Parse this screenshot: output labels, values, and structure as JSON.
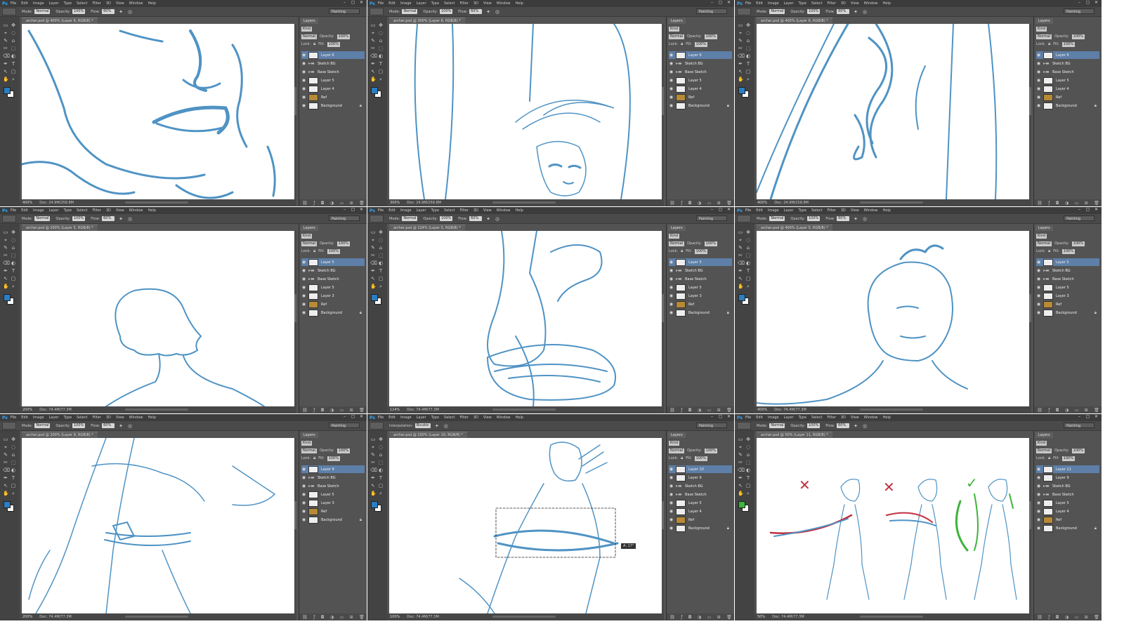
{
  "ps_logo": "Ps",
  "menus": [
    "File",
    "Edit",
    "Image",
    "Layer",
    "Type",
    "Select",
    "Filter",
    "3D",
    "View",
    "Window",
    "Help"
  ],
  "window_controls": [
    "–",
    "▢",
    "✕"
  ],
  "workspace": "Painting",
  "options": {
    "mode_label": "Mode:",
    "mode_value": "Normal",
    "opacity_label": "Opacity:",
    "opacity_value": "100%",
    "flow_label": "Flow:",
    "flow_value": "60%"
  },
  "colors": {
    "fg_swatch": "#2a7fc4",
    "fg_swatch_green": "#38b83a",
    "bg_swatch": "#ffffff",
    "sketch_stroke": "#4f93c4",
    "sketch_stroke_light": "#9cc6e2",
    "red_mark": "#c23040",
    "green_mark": "#3fb33a",
    "layer_selected": "#5d7fa8"
  },
  "layers_panel": {
    "tab": "Layers",
    "kind_value": "Kind",
    "blend_value": "Normal",
    "opacity_label": "Opacity:",
    "opacity_value": "100%",
    "lock_label": "Lock:",
    "fill_label": "Fill:",
    "fill_value": "100%"
  },
  "windows": [
    {
      "doc_tab": "archer.psd @ 400% (Layer 6, RGB/8) *",
      "zoom": "400%",
      "doc_info": "Doc: 24.9M/258.8M",
      "layers": [
        {
          "name": "Layer 6",
          "type": "layer",
          "selected": true
        },
        {
          "name": "Sketch BG",
          "type": "folder",
          "selected": false
        },
        {
          "name": "Base Sketch",
          "type": "folder",
          "selected": false
        },
        {
          "name": "Layer 5",
          "type": "layer",
          "selected": false
        },
        {
          "name": "Layer 4",
          "type": "layer",
          "selected": false
        },
        {
          "name": "Ref",
          "type": "ref",
          "selected": false
        },
        {
          "name": "Background",
          "type": "bg",
          "selected": false
        }
      ]
    },
    {
      "doc_tab": "archer.psd @ 300% (Layer 6, RGB/8) *",
      "zoom": "300%",
      "doc_info": "Doc: 24.9M/258.8M",
      "layers": [
        {
          "name": "Layer 6",
          "type": "layer",
          "selected": true
        },
        {
          "name": "Sketch BG",
          "type": "folder",
          "selected": false
        },
        {
          "name": "Base Sketch",
          "type": "folder",
          "selected": false
        },
        {
          "name": "Layer 5",
          "type": "layer",
          "selected": false
        },
        {
          "name": "Layer 4",
          "type": "layer",
          "selected": false
        },
        {
          "name": "Ref",
          "type": "ref",
          "selected": false
        },
        {
          "name": "Background",
          "type": "bg",
          "selected": false
        }
      ]
    },
    {
      "doc_tab": "archer.psd @ 400% (Layer 6, RGB/8) *",
      "zoom": "400%",
      "doc_info": "Doc: 24.9M/258.8M",
      "layers": [
        {
          "name": "Layer 6",
          "type": "layer",
          "selected": true
        },
        {
          "name": "Sketch BG",
          "type": "folder",
          "selected": false
        },
        {
          "name": "Base Sketch",
          "type": "folder",
          "selected": false
        },
        {
          "name": "Layer 5",
          "type": "layer",
          "selected": false
        },
        {
          "name": "Layer 4",
          "type": "layer",
          "selected": false
        },
        {
          "name": "Ref",
          "type": "ref",
          "selected": false
        },
        {
          "name": "Background",
          "type": "bg",
          "selected": false
        }
      ]
    },
    {
      "doc_tab": "archer.psd @ 200% (Layer 5, RGB/8) *",
      "zoom": "200%",
      "doc_info": "Doc: 74.4M/77.3M",
      "layers": [
        {
          "name": "Layer 5",
          "type": "layer",
          "selected": true
        },
        {
          "name": "Sketch BG",
          "type": "folder",
          "selected": false
        },
        {
          "name": "Base Sketch",
          "type": "folder",
          "selected": false
        },
        {
          "name": "Layer 5",
          "type": "layer",
          "selected": false
        },
        {
          "name": "Layer 3",
          "type": "layer",
          "selected": false
        },
        {
          "name": "Ref",
          "type": "ref",
          "selected": false
        },
        {
          "name": "Background",
          "type": "bg",
          "selected": false
        }
      ]
    },
    {
      "doc_tab": "archer.psd @ 124% (Layer 5, RGB/8) *",
      "zoom": "124%",
      "doc_info": "Doc: 74.4M/77.3M",
      "layers": [
        {
          "name": "Layer 5",
          "type": "layer",
          "selected": true
        },
        {
          "name": "Sketch BG",
          "type": "folder",
          "selected": false
        },
        {
          "name": "Base Sketch",
          "type": "folder",
          "selected": false
        },
        {
          "name": "Layer 5",
          "type": "layer",
          "selected": false
        },
        {
          "name": "Layer 3",
          "type": "layer",
          "selected": false
        },
        {
          "name": "Ref",
          "type": "ref",
          "selected": false
        },
        {
          "name": "Background",
          "type": "bg",
          "selected": false
        }
      ]
    },
    {
      "doc_tab": "archer.psd @ 400% (Layer 5, RGB/8) *",
      "zoom": "400%",
      "doc_info": "Doc: 74.4M/77.3M",
      "layers": [
        {
          "name": "Layer 5",
          "type": "layer",
          "selected": true
        },
        {
          "name": "Sketch BG",
          "type": "folder",
          "selected": false
        },
        {
          "name": "Base Sketch",
          "type": "folder",
          "selected": false
        },
        {
          "name": "Layer 5",
          "type": "layer",
          "selected": false
        },
        {
          "name": "Layer 3",
          "type": "layer",
          "selected": false
        },
        {
          "name": "Ref",
          "type": "ref",
          "selected": false
        },
        {
          "name": "Background",
          "type": "bg",
          "selected": false
        }
      ]
    },
    {
      "doc_tab": "archer.psd @ 200% (Layer 9, RGB/8) *",
      "zoom": "200%",
      "doc_info": "Doc: 74.4M/77.3M",
      "layers": [
        {
          "name": "Layer 9",
          "type": "layer",
          "selected": true
        },
        {
          "name": "Sketch BG",
          "type": "folder",
          "selected": false
        },
        {
          "name": "Base Sketch",
          "type": "folder",
          "selected": false
        },
        {
          "name": "Layer 5",
          "type": "layer",
          "selected": false
        },
        {
          "name": "Layer 3",
          "type": "layer",
          "selected": false
        },
        {
          "name": "Ref",
          "type": "ref",
          "selected": false
        },
        {
          "name": "Background",
          "type": "bg",
          "selected": false
        }
      ]
    },
    {
      "doc_tab": "archer.psd @ 100% (Layer 10, RGB/8) *",
      "zoom": "100%",
      "doc_info": "Doc: 74.4M/77.3M",
      "transform_label": "Interpolation:",
      "transform_value": "Bicubic",
      "tooltip": "A: 17°",
      "layers": [
        {
          "name": "Layer 10",
          "type": "layer",
          "selected": true
        },
        {
          "name": "Layer 9",
          "type": "layer",
          "selected": false
        },
        {
          "name": "Sketch BG",
          "type": "folder",
          "selected": false
        },
        {
          "name": "Base Sketch",
          "type": "folder",
          "selected": false
        },
        {
          "name": "Layer 5",
          "type": "layer",
          "selected": false
        },
        {
          "name": "Layer 4",
          "type": "layer",
          "selected": false
        },
        {
          "name": "Ref",
          "type": "ref",
          "selected": false
        },
        {
          "name": "Background",
          "type": "bg",
          "selected": false
        }
      ]
    },
    {
      "doc_tab": "archer.psd @ 50% (Layer 11, RGB/8) *",
      "zoom": "50%",
      "doc_info": "Doc: 74.4M/77.3M",
      "marks": [
        "✕",
        "✕",
        "✓"
      ],
      "layers": [
        {
          "name": "Layer 11",
          "type": "layer",
          "selected": true
        },
        {
          "name": "Layer 9",
          "type": "layer",
          "selected": false
        },
        {
          "name": "Sketch BG",
          "type": "folder",
          "selected": false
        },
        {
          "name": "Base Sketch",
          "type": "folder",
          "selected": false
        },
        {
          "name": "Layer 5",
          "type": "layer",
          "selected": false
        },
        {
          "name": "Layer 4",
          "type": "layer",
          "selected": false
        },
        {
          "name": "Ref",
          "type": "ref",
          "selected": false
        },
        {
          "name": "Background",
          "type": "bg",
          "selected": false
        }
      ]
    }
  ],
  "icons": {
    "eye": "eye-icon",
    "folder": "folder-icon",
    "lock": "lock-icon",
    "brush": "brush-icon"
  }
}
